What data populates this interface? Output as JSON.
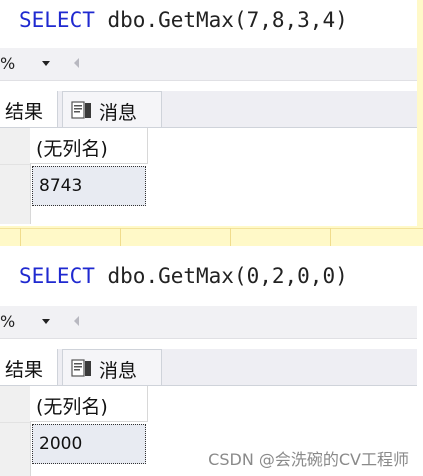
{
  "queries": [
    {
      "keyword": "SELECT",
      "expression": "dbo.GetMax(7,8,3,4)",
      "zoom_text": "%",
      "tabs": {
        "results": "结果",
        "messages": "消息"
      },
      "column_header": "(无列名)",
      "result_value": "8743"
    },
    {
      "keyword": "SELECT",
      "expression": "dbo.GetMax(0,2,0,0)",
      "zoom_text": "%",
      "tabs": {
        "results": "结果",
        "messages": "消息"
      },
      "column_header": "(无列名)",
      "result_value": "2000"
    }
  ],
  "watermark": "CSDN @会洗碗的CV工程师",
  "colors": {
    "keyword": "#1f29d0",
    "top_background": "#fff9c8",
    "toolbar": "#f1f1f4",
    "cell_selected": "#e8ebf2"
  }
}
